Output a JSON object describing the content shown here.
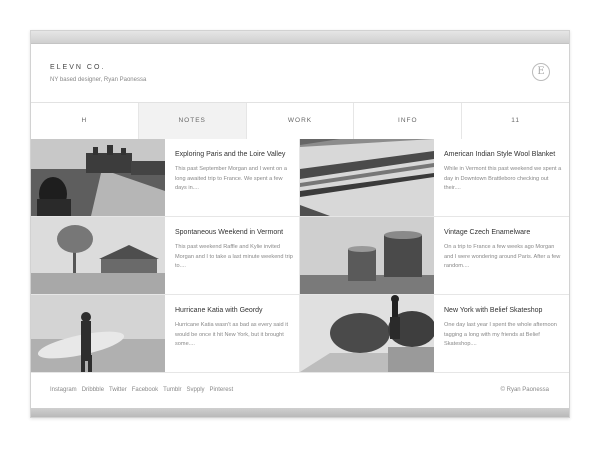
{
  "header": {
    "brand": "ELEVN CO.",
    "tagline": "NY based designer, Ryan Paonessa",
    "logo_letter": "E"
  },
  "nav": {
    "items": [
      {
        "label": "H"
      },
      {
        "label": "NOTES"
      },
      {
        "label": "WORK"
      },
      {
        "label": "INFO"
      },
      {
        "label": "11"
      }
    ],
    "active_index": 1
  },
  "posts": [
    {
      "title": "Exploring Paris and the Loire Valley",
      "excerpt": "This past September Morgan and I went on a long awaited trip to France. We spent a few days in....",
      "image": "chateau-road-photo"
    },
    {
      "title": "American Indian Style Wool Blanket",
      "excerpt": "While in Vermont this past weekend we spent a day in Downtown Brattleboro checking out their....",
      "image": "striped-blanket-photo"
    },
    {
      "title": "Spontaneous Weekend in Vermont",
      "excerpt": "This past weekend Raffle and Kylie invited Morgan and I to take a last minute weekend trip to....",
      "image": "foggy-barn-photo"
    },
    {
      "title": "Vintage Czech Enamelware",
      "excerpt": "On a trip to France a few weeks ago Morgan and I were wondering around Paris. After a few random....",
      "image": "enamel-cups-photo"
    },
    {
      "title": "Hurricane Katia with Geordy",
      "excerpt": "Hurricane Katia wasn't as bad as every said it would be once it hit New York, but it brought some....",
      "image": "surfer-beach-photo"
    },
    {
      "title": "New York with Belief Skateshop",
      "excerpt": "One day last year I spent the whole afternoon tagging a long with my friends at Belief Skateshop....",
      "image": "skater-ramp-photo"
    }
  ],
  "footer": {
    "social": [
      "Instagram",
      "Dribbble",
      "Twitter",
      "Facebook",
      "Tumblr",
      "Svpply",
      "Pinterest"
    ],
    "copyright": "© Ryan Paonessa"
  }
}
